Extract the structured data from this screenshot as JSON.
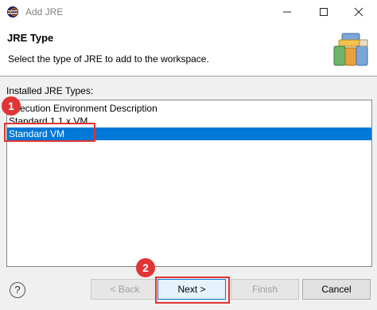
{
  "window": {
    "title": "Add JRE"
  },
  "header": {
    "title": "JRE Type",
    "description": "Select the type of JRE to add to the workspace.",
    "graphic_icon": "books-icon"
  },
  "list": {
    "label": "Installed JRE Types:",
    "items": [
      {
        "label": "Execution Environment Description",
        "selected": false
      },
      {
        "label": "Standard 1.1.x VM",
        "selected": false
      },
      {
        "label": "Standard VM",
        "selected": true
      }
    ]
  },
  "callouts": {
    "step1": "1",
    "step2": "2"
  },
  "buttons": {
    "help": "?",
    "back": "< Back",
    "next": "Next >",
    "finish": "Finish",
    "cancel": "Cancel"
  },
  "colors": {
    "selection": "#0078d7",
    "callout": "#e03535"
  }
}
